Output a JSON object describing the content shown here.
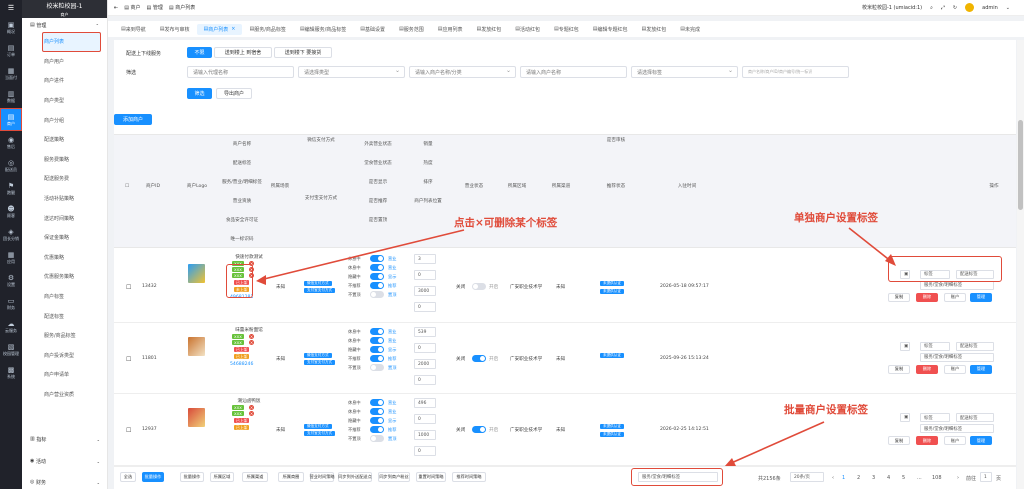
{
  "app": {
    "title": "校米粒校园-1",
    "subtitle": "商户"
  },
  "iconbar": [
    {
      "name": "overview",
      "label": "概况",
      "glyph": "▣"
    },
    {
      "name": "orders",
      "label": "订单",
      "glyph": "▤"
    },
    {
      "name": "checkout",
      "label": "当面付",
      "glyph": "▦"
    },
    {
      "name": "data",
      "label": "数据",
      "glyph": "▥"
    },
    {
      "name": "merchant",
      "label": "商户",
      "glyph": "▤",
      "active": true
    },
    {
      "name": "aftersale",
      "label": "售后",
      "glyph": "◉"
    },
    {
      "name": "delivery",
      "label": "配送员",
      "glyph": "◎"
    },
    {
      "name": "runner",
      "label": "跑腿",
      "glyph": "⚑"
    },
    {
      "name": "users",
      "label": "顾客",
      "glyph": "☻"
    },
    {
      "name": "group",
      "label": "团长分销",
      "glyph": "◈"
    },
    {
      "name": "apps",
      "label": "应用",
      "glyph": "▦"
    },
    {
      "name": "settings",
      "label": "设置",
      "glyph": "⚙"
    },
    {
      "name": "finance",
      "label": "财务",
      "glyph": "▭"
    },
    {
      "name": "cloud",
      "label": "云服务",
      "glyph": "☁"
    },
    {
      "name": "school",
      "label": "校园管理",
      "glyph": "▧"
    },
    {
      "name": "system",
      "label": "系统",
      "glyph": "▩"
    }
  ],
  "submenu": {
    "group_manage": "管理",
    "items": [
      {
        "label": "商户列表",
        "active": true
      },
      {
        "label": "商户用户"
      },
      {
        "label": "商户进件"
      },
      {
        "label": "商户类型"
      },
      {
        "label": "商户分组"
      },
      {
        "label": "配送策略"
      },
      {
        "label": "服务费策略"
      },
      {
        "label": "配送服务费"
      },
      {
        "label": "活动补贴策略"
      },
      {
        "label": "送达时间策略"
      },
      {
        "label": "保证金策略"
      },
      {
        "label": "优惠策略"
      },
      {
        "label": "优惠服务策略"
      },
      {
        "label": "商户标签"
      },
      {
        "label": "配送标签"
      },
      {
        "label": "服务/商品标签"
      },
      {
        "label": "商户投诉类型"
      },
      {
        "label": "商户申请单"
      },
      {
        "label": "商户营业资质"
      }
    ],
    "group_score": "指标",
    "group_activity": "活动",
    "group_finance": "财务"
  },
  "header": {
    "crumbs": [
      "商户",
      "管理",
      "商户列表"
    ],
    "school": "校米粒校园-1 (umiacid:1)",
    "user": "admin"
  },
  "tabs": [
    "来到导航",
    "发布与审核",
    "商户列表",
    "服务/商品标签",
    "编辑服务/商品标签",
    "基础设置",
    "服务范围",
    "应用列表",
    "发放红包",
    "活动红包",
    "专题红包",
    "编辑专题红包",
    "发放红包",
    "未完成"
  ],
  "filters": {
    "delivery_label": "配送上下线服务",
    "delivery_opts": [
      "不限",
      "送到楼上 到宿舍",
      "送到楼下 要接货"
    ],
    "filter_label": "筛选",
    "inputs": [
      "请输入代理名称",
      "请选择类型",
      "请输入商户名称/分类",
      "请输入商户名称",
      "请选择标签",
      "商户名称/商户ID/商户编号/统一标识"
    ],
    "search": "筛选",
    "export": "导出商户"
  },
  "add_button": "添加商户",
  "table": {
    "headers": {
      "checkbox": "",
      "id": "商户ID",
      "logo": "商户Logo",
      "name_stack": [
        "商户名称",
        "配送标签",
        "服务/营业/明细标签",
        "营业资质",
        "食品安全许可证",
        "唯一标识码"
      ],
      "scene": "所属场景",
      "pay": [
        "微信支付方式",
        "",
        "支付宝支付方式"
      ],
      "status": [
        "外卖营业状态",
        "堂食营业状态",
        "是否显示",
        "是否推荐",
        "是否置顶"
      ],
      "sort": [
        "销量",
        "热度",
        "排序",
        "商户列表位置"
      ],
      "open": "营业状态",
      "area": "所属区域",
      "agent": "所属渠道",
      "apply": [
        "是否审核",
        "推荐状态"
      ],
      "time": "入驻时间",
      "ops": "操作"
    },
    "rows": [
      {
        "id": "13432",
        "name": "快速付款测试",
        "tags": [
          "XXX",
          "XXX",
          "XXX"
        ],
        "status_tags": [
          "已上架",
          "未上架"
        ],
        "code": "49681281",
        "scene": "未知",
        "pay1": "微信支付方式",
        "pay2": "支付宝支付方式",
        "sort_vals": [
          "3",
          "0",
          "3000",
          "0"
        ],
        "open_label": [
          "关闭",
          "开启"
        ],
        "area": "广安职业技术学",
        "agent": "未知",
        "badges": [
          "未提供认证",
          "未提供认证"
        ],
        "time": "2026-05-18 09:57:17",
        "op_selects": [
          "标签",
          "配送标签"
        ],
        "op_select_wide": "服务/堂食/明细标签",
        "op_btns": [
          "复制",
          "删除",
          "账户",
          "管理"
        ]
      },
      {
        "id": "11801",
        "name": "味蕾米粉面馆",
        "tags": [
          "XXX",
          "XXX"
        ],
        "status_tags": [
          "已上架",
          "已上架"
        ],
        "code": "54688246",
        "scene": "未知",
        "pay1": "微信支付方式",
        "pay2": "支付宝支付方式",
        "sort_vals": [
          "539",
          "0",
          "2000",
          "0"
        ],
        "open_label": [
          "关闭",
          "开启"
        ],
        "area": "广安职业技术学",
        "agent": "未知",
        "badges": [
          "未提供认证"
        ],
        "time": "2025-09-26 15:13:24",
        "op_selects": [
          "标签",
          "配送标签"
        ],
        "op_select_wide": "服务/堂食/明细标签",
        "op_btns": [
          "复制",
          "删除",
          "账户",
          "管理"
        ]
      },
      {
        "id": "12937",
        "name": "潮汕卤鸭饭",
        "tags": [
          "XXX",
          "XXX"
        ],
        "status_tags": [
          "已上架",
          "已上架"
        ],
        "code": "",
        "scene": "未知",
        "pay1": "微信支付方式",
        "pay2": "支付宝支付方式",
        "sort_vals": [
          "496",
          "0",
          "1000",
          "0"
        ],
        "open_label": [
          "关闭",
          "开启"
        ],
        "area": "广安职业技术学",
        "agent": "未知",
        "badges": [
          "未提供认证",
          "未提供认证"
        ],
        "time": "2026-02-25 14:12:51",
        "op_selects": [
          "标签",
          "配送标签"
        ],
        "op_select_wide": "服务/堂食/明细标签",
        "op_btns": [
          "复制",
          "删除",
          "账户",
          "管理"
        ]
      }
    ],
    "status_labels": [
      "休息中",
      "营业",
      "休息中",
      "营业",
      "隐藏中",
      "显示",
      "不推荐",
      "推荐",
      "不置顶",
      "置顶"
    ]
  },
  "annotations": {
    "delete_tag": "点击×可删除某个标签",
    "single": "单独商户设置标签",
    "batch": "批量商户设置标签"
  },
  "footer": {
    "left_btns": [
      "全选",
      "批量操作",
      "批量操作",
      "所属区域",
      "所属渠道",
      "所属商圈",
      "营业时间策略",
      "同步到外送配送点",
      "同步到商户粉丝",
      "重置时间策略",
      "推荐时间策略"
    ],
    "select_wide": "服务/堂食/明细标签",
    "total": "共2156条",
    "page_size": "20条/页",
    "pages": [
      "1",
      "2",
      "3",
      "4",
      "5",
      "...",
      "108"
    ],
    "goto": "前往",
    "page_input": "1",
    "page_unit": "页"
  },
  "colors": {
    "primary": "#1890ff",
    "danger": "#f05050",
    "annotation": "#e04b3a",
    "sidebar": "#20222a"
  }
}
